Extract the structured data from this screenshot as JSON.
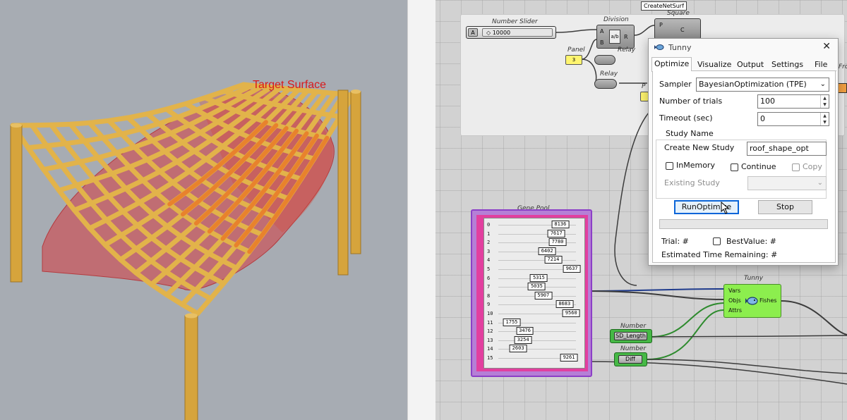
{
  "viewport": {
    "target_label": "Target Surface",
    "colors": {
      "background": "#a7acb3",
      "frame": "#e2b34a",
      "surface": "#c8585e",
      "highlight": "#e8822c"
    }
  },
  "canvas": {
    "create_label": "CreateNetSurf",
    "number_slider": {
      "title": "Number Slider",
      "tag": "A",
      "value": "◇ 10000"
    },
    "division": {
      "title": "Division",
      "in_a": "A",
      "in_b": "B",
      "out_r": "R",
      "glyph": "a/b"
    },
    "square": {
      "title": "Square",
      "in": "P",
      "out": "C"
    },
    "panel": {
      "title": "Panel",
      "value": "3"
    },
    "relay_1": {
      "title": "Relay"
    },
    "relay_2": {
      "title": "Relay"
    },
    "front_label": "Fron",
    "partial_label": "P",
    "gene_pool": {
      "title": "Gene Pool",
      "genes": [
        {
          "index": "0",
          "value": "8136"
        },
        {
          "index": "1",
          "value": "7617"
        },
        {
          "index": "2",
          "value": "7780"
        },
        {
          "index": "3",
          "value": "6402"
        },
        {
          "index": "4",
          "value": "7214"
        },
        {
          "index": "5",
          "value": "9637"
        },
        {
          "index": "6",
          "value": "5315"
        },
        {
          "index": "7",
          "value": "5035"
        },
        {
          "index": "8",
          "value": "5907"
        },
        {
          "index": "9",
          "value": "8683"
        },
        {
          "index": "10",
          "value": "9560"
        },
        {
          "index": "11",
          "value": "1755"
        },
        {
          "index": "12",
          "value": "3476"
        },
        {
          "index": "13",
          "value": "3254"
        },
        {
          "index": "14",
          "value": "2603"
        },
        {
          "index": "15",
          "value": "9261"
        }
      ]
    },
    "number_1": {
      "title": "Number",
      "value": "SD_Length"
    },
    "number_2": {
      "title": "Number",
      "value": "Diff"
    },
    "tunny": {
      "title": "Tunny",
      "in_vars": "Vars",
      "in_objs": "Objs",
      "in_attrs": "Attrs",
      "out_fishes": "Fishes"
    }
  },
  "dialog": {
    "title": "Tunny",
    "close": "✕",
    "tabs": [
      "Optimize",
      "Visualize",
      "Output",
      "Settings",
      "File"
    ],
    "sampler_label": "Sampler",
    "sampler_value": "BayesianOptimization (TPE)",
    "trials_label": "Number of trials",
    "trials_value": "100",
    "timeout_label": "Timeout (sec)",
    "timeout_value": "0",
    "study_name_label": "Study Name",
    "create_new_label": "Create New Study",
    "create_new_value": "roof_shape_opt",
    "inmemory_label": "InMemory",
    "continue_label": "Continue",
    "copy_label": "Copy",
    "existing_label": "Existing Study",
    "existing_value": "",
    "run_button": "RunOptimize",
    "stop_button": "Stop",
    "trial_label": "Trial: #",
    "bestvalue_label": "BestValue: #",
    "eta_label": "Estimated Time Remaining: #"
  }
}
